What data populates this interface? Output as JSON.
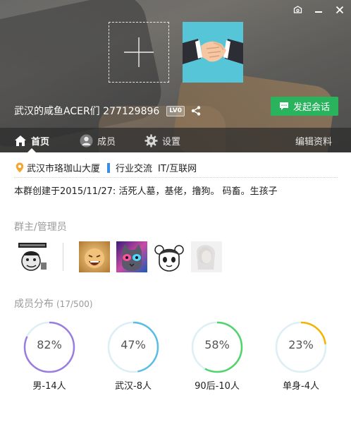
{
  "group": {
    "name": "武汉的咸鱼ACER们 277129896",
    "level": "LV0",
    "chat_button": "发起会话"
  },
  "tabs": [
    {
      "label": "首页",
      "icon": "home-icon",
      "active": true
    },
    {
      "label": "成员",
      "icon": "person-icon",
      "active": false
    },
    {
      "label": "设置",
      "icon": "gear-icon",
      "active": false
    }
  ],
  "edit_profile": "编辑资料",
  "info": {
    "location": "武汉市珞珈山大厦",
    "category": "行业交流",
    "subcategory": "IT/互联网",
    "intro": "本群创建于2015/11/27:  活死人墓，基佬，撸狗。 码畜。生孩子"
  },
  "admins_section": {
    "title": "群主/管理员"
  },
  "members_section": {
    "title": "成员分布",
    "count": "(17/500)"
  },
  "stats": [
    {
      "percent_text": "82%",
      "label": "男-14人",
      "value": 82,
      "color": "#9b7ce0"
    },
    {
      "percent_text": "47%",
      "label": "武汉-8人",
      "value": 47,
      "color": "#5bbce6"
    },
    {
      "percent_text": "58%",
      "label": "90后-10人",
      "value": 58,
      "color": "#4fd46a"
    },
    {
      "percent_text": "23%",
      "label": "单身-4人",
      "value": 23,
      "color": "#f4b400"
    }
  ],
  "colors": {
    "accent_green": "#29b35d",
    "track": "#dceff5"
  }
}
